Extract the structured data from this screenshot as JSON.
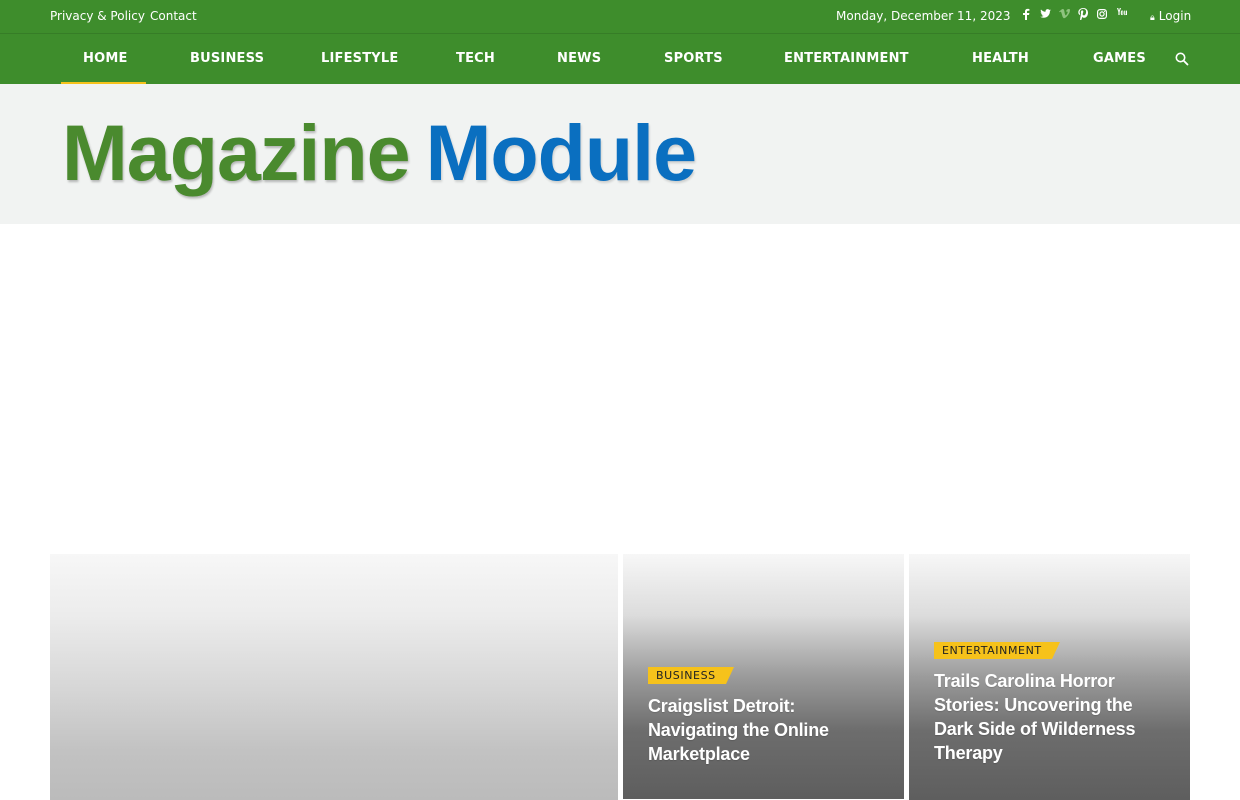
{
  "topbar": {
    "links": [
      "Privacy & Policy",
      "Contact"
    ],
    "date": "Monday, December 11, 2023",
    "social_icons": [
      "facebook-icon",
      "twitter-icon",
      "vimeo-icon",
      "pinterest-icon",
      "instagram-icon",
      "youtube-icon"
    ],
    "login_label": "Login"
  },
  "nav": {
    "items": [
      "Home",
      "Business",
      "Lifestyle",
      "Tech",
      "News",
      "Sports",
      "Entertainment",
      "Health",
      "Games"
    ],
    "active": "Home"
  },
  "logo": {
    "word1": "Magazine",
    "word2": "Module"
  },
  "features": [
    {
      "category": "",
      "title": ""
    },
    {
      "category": "Business",
      "title": "Craigslist Detroit: Navigating the Online Marketplace"
    },
    {
      "category": "Entertainment",
      "title": "Trails Carolina Horror Stories: Uncovering the Dark Side of Wilderness Therapy"
    }
  ],
  "colors": {
    "green": "#3e8d2c",
    "accent": "#f6c21b",
    "logo_green": "#4a8a2e",
    "logo_blue": "#0a6fc0"
  }
}
